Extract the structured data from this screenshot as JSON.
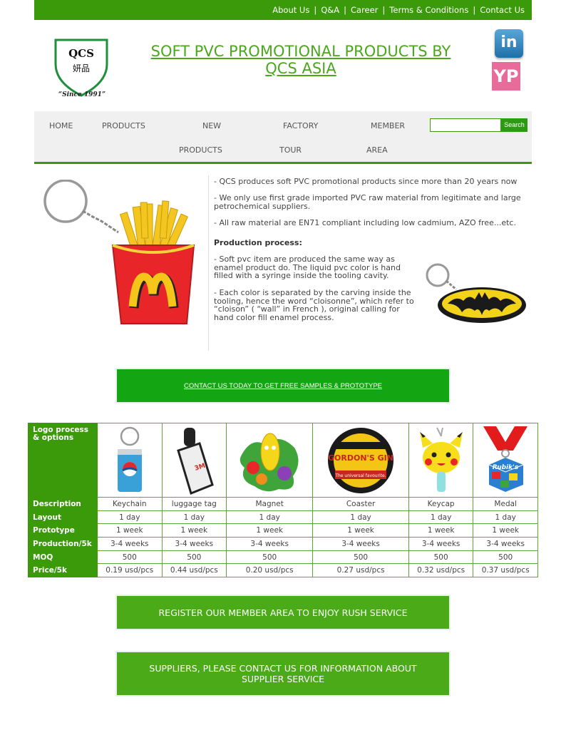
{
  "topnav": {
    "links": [
      "About Us",
      "Q&A",
      "Career",
      "Terms & Conditions",
      "Contact Us"
    ]
  },
  "logo": {
    "text": "QCS",
    "chinese": "妍品",
    "since": "“Since 1991”"
  },
  "site_title": "SOFT PVC PROMOTIONAL PRODUCTS BY QCS ASIA",
  "social": {
    "linkedin": "in",
    "yp": "YP"
  },
  "nav": {
    "home": "HOME",
    "products": "PRODUCTS",
    "new1": "NEW",
    "new2": "PRODUCTS",
    "factory1": "FACTORY",
    "factory2": "TOUR",
    "member1": "MEMBER",
    "member2": "AREA",
    "search_button": "Search",
    "search_value": ""
  },
  "intro": {
    "p1": "- QCS produces soft PVC promotional products since more than 20 years now",
    "p2": "- We only use first grade imported PVC raw material from legitimate and large petrochemical suppliers.",
    "p3": "- All raw material are EN71 compliant including low cadmium, AZO free...etc.",
    "heading": "Production process:",
    "p4": "- Soft pvc item are produced the same way as enamel product do. The liquid pvc color is hand filled with a syringe inside the tooling cavity.",
    "p5": "- Each color is separated by the carving inside the tooling, hence the word “cloisonne”, which refer to “cloison” ( “wall” in French ), original calling for hand color fill enamel process."
  },
  "cta1": "CONTACT US TODAY TO GET FREE SAMPLES & PROTOTYPE",
  "table": {
    "header": "Logo process & options",
    "rows": [
      {
        "label": "Description",
        "cells": [
          "Keychain",
          "luggage tag",
          "Magnet",
          "Coaster",
          "Keycap",
          "Medal"
        ]
      },
      {
        "label": "Layout",
        "cells": [
          "1 day",
          "1 day",
          "1 day",
          "1 day",
          "1 day",
          "1 day"
        ]
      },
      {
        "label": "Prototype",
        "cells": [
          "1 week",
          "1 week",
          "1 week",
          "1 week",
          "1 week",
          "1 week"
        ]
      },
      {
        "label": "Production/5k",
        "cells": [
          "3-4 weeks",
          "3-4 weeks",
          "3-4 weeks",
          "3-4 weeks",
          "3-4 weeks",
          "3-4 weeks"
        ]
      },
      {
        "label": "MOQ",
        "cells": [
          "500",
          "500",
          "500",
          "500",
          "500",
          "500"
        ]
      },
      {
        "label": "Price/5k",
        "cells": [
          "0.19 usd/pcs",
          "0.44 usd/pcs",
          "0.20 usd/pcs",
          "0.27 usd/pcs",
          "0.32 usd/pcs",
          "0.37 usd/pcs"
        ]
      }
    ],
    "coaster_text": "GORDON'S GIN",
    "coaster_sub": "The universal favourite.",
    "luggage_text": "3M",
    "medal_text": "Rubik's"
  },
  "cta2": "REGISTER OUR MEMBER AREA TO ENJOY RUSH SERVICE",
  "cta3": "SUPPLIERS, PLEASE CONTACT US FOR INFORMATION ABOUT SUPPLIER SERVICE",
  "colors": {
    "brand_green": "#3a9a0a",
    "cta_green": "#13a612",
    "title_green": "#4aa81a"
  }
}
